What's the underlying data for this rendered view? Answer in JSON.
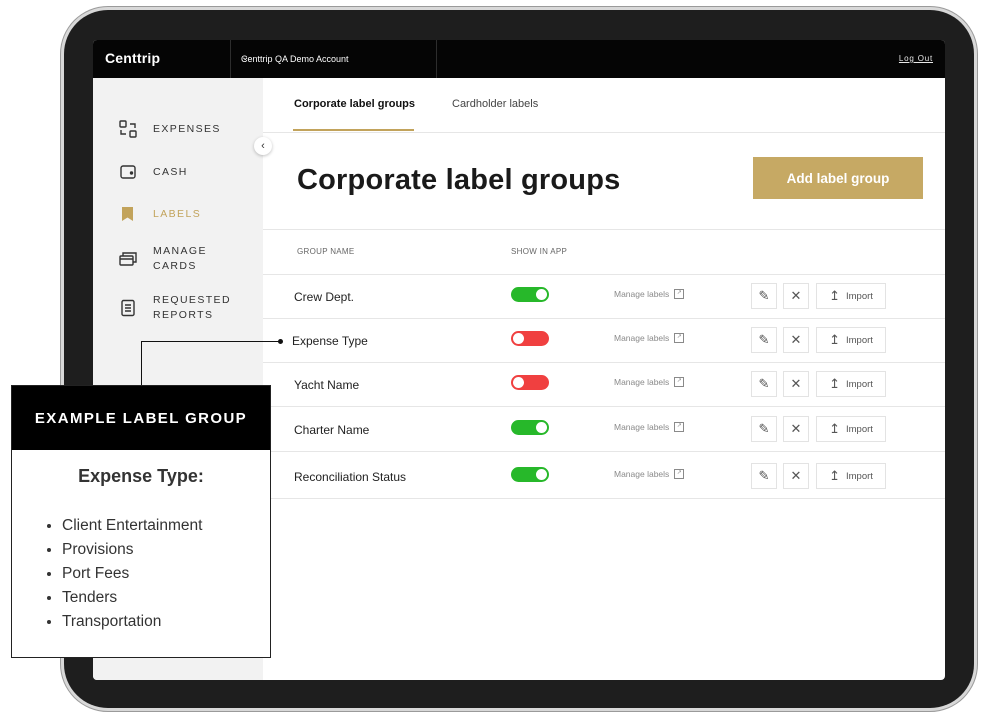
{
  "app": {
    "brand": "Centtrip",
    "account": "Centtrip QA Demo Account",
    "logout": "Log Out"
  },
  "sidebar": {
    "items": [
      {
        "label": "EXPENSES",
        "icon": "expenses-icon"
      },
      {
        "label": "CASH",
        "icon": "wallet-icon"
      },
      {
        "label": "LABELS",
        "icon": "bookmark-icon",
        "active": true
      },
      {
        "label": "MANAGE CARDS",
        "icon": "cards-icon"
      },
      {
        "label": "REQUESTED REPORTS",
        "icon": "report-icon"
      }
    ]
  },
  "tabs": [
    "Corporate label groups",
    "Cardholder labels"
  ],
  "main": {
    "title": "Corporate label groups",
    "add_button": "Add label group",
    "columns": [
      "GROUP NAME",
      "SHOW IN APP"
    ]
  },
  "rows": [
    {
      "name": "Crew Dept.",
      "show_in_app": true,
      "manage": "Manage labels",
      "import": "Import"
    },
    {
      "name": "Expense Type",
      "show_in_app": false,
      "manage": "Manage labels",
      "import": "Import"
    },
    {
      "name": "Yacht Name",
      "show_in_app": false,
      "manage": "Manage labels",
      "import": "Import"
    },
    {
      "name": "Charter Name",
      "show_in_app": true,
      "manage": "Manage labels",
      "import": "Import"
    },
    {
      "name": "Reconciliation Status",
      "show_in_app": true,
      "manage": "Manage labels",
      "import": "Import"
    }
  ],
  "callout": {
    "header": "EXAMPLE LABEL GROUP",
    "title": "Expense Type:",
    "items": [
      "Client Entertainment",
      "Provisions",
      "Port Fees",
      "Tenders",
      "Transportation"
    ]
  },
  "colors": {
    "accent": "#c6a964",
    "toggle_on": "#27b82a",
    "toggle_off": "#f04040"
  }
}
